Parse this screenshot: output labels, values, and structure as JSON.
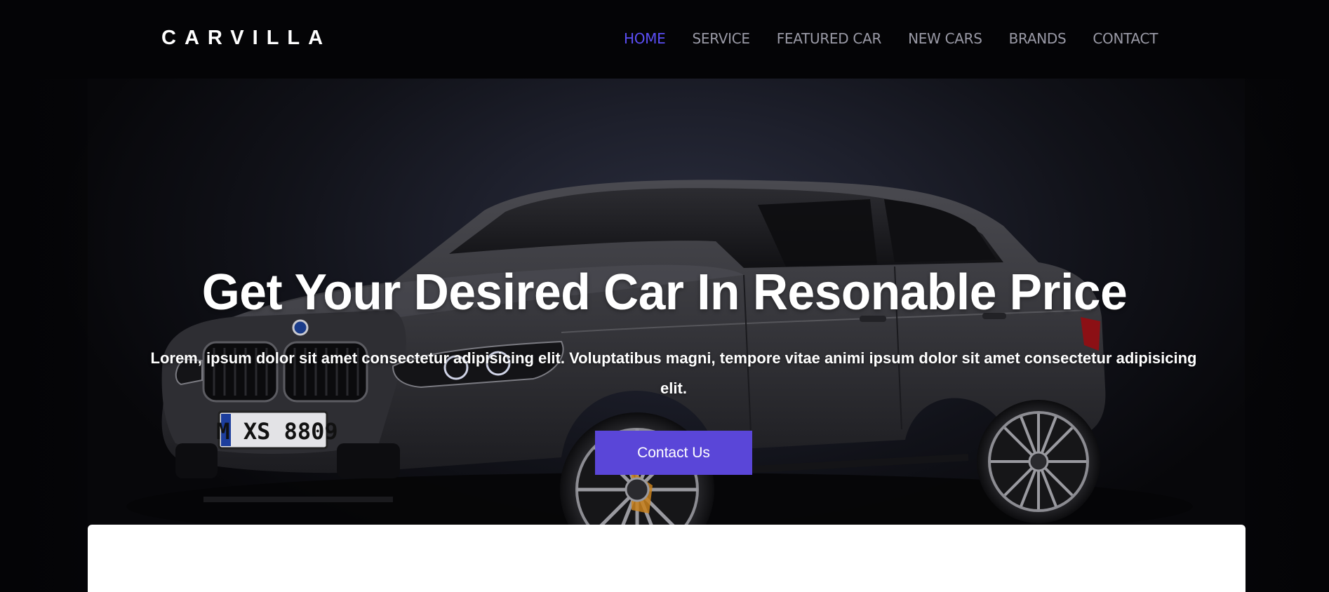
{
  "brand": {
    "name": "CARVILLA"
  },
  "nav": {
    "items": [
      {
        "label": "HOME",
        "active": true
      },
      {
        "label": "SERVICE",
        "active": false
      },
      {
        "label": "FEATURED CAR",
        "active": false
      },
      {
        "label": "NEW CARS",
        "active": false
      },
      {
        "label": "BRANDS",
        "active": false
      },
      {
        "label": "CONTACT",
        "active": false
      }
    ]
  },
  "hero": {
    "title": "Get Your Desired Car In Resonable Price",
    "subtitle": "Lorem, ipsum dolor sit amet consectetur adipisicing elit. Voluptatibus magni, tempore vitae animi ipsum dolor sit amet consectetur adipisicing elit.",
    "cta_label": "Contact Us",
    "license_plate": "M XS 8809"
  },
  "colors": {
    "accent": "#5b4ef5",
    "button": "#5a46d8",
    "nav_text": "#9a9aa6",
    "background": "#040406",
    "car_body": "#3a3a3e"
  },
  "icons": {
    "car_image": "car-hero-image"
  }
}
